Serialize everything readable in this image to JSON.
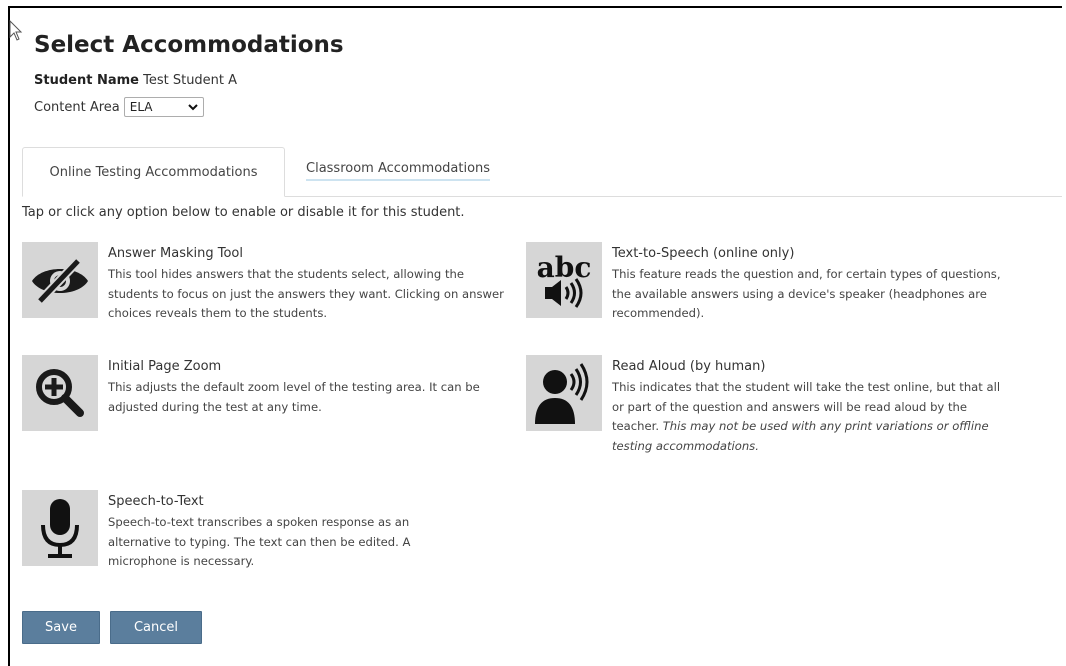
{
  "page": {
    "title": "Select Accommodations"
  },
  "student": {
    "label": "Student Name",
    "value": "Test Student A"
  },
  "content_area": {
    "label": "Content Area",
    "selected": "ELA"
  },
  "tabs": [
    {
      "label": "Online Testing Accommodations",
      "active": true
    },
    {
      "label": "Classroom Accommodations",
      "active": false
    }
  ],
  "hint": "Tap or click any option below to enable or disable it for this student.",
  "accommodations": {
    "answer_masking": {
      "icon": "eye-slash-icon",
      "title": "Answer Masking Tool",
      "desc": "This tool hides answers that the students select, allowing the students to focus on just the answers they want. Clicking on answer choices reveals them to the students."
    },
    "text_to_speech": {
      "icon": "abc-speaker-icon",
      "icon_text": "abc",
      "title": "Text-to-Speech (online only)",
      "desc": "This feature reads the question and, for certain types of questions, the available answers using a device's speaker (headphones are recommended)."
    },
    "page_zoom": {
      "icon": "zoom-in-icon",
      "title": "Initial Page Zoom",
      "desc": "This adjusts the default zoom level of the testing area. It can be adjusted during the test at any time."
    },
    "read_aloud": {
      "icon": "person-speaking-icon",
      "title": "Read Aloud (by human)",
      "desc": "This indicates that the student will take the test online, but that all or part of the question and answers will be read aloud by the teacher.",
      "desc_italic": "This may not be used with any print variations or offline testing accommodations."
    },
    "speech_to_text": {
      "icon": "microphone-icon",
      "title": "Speech-to-Text",
      "desc": "Speech-to-text transcribes a spoken response as an alternative to typing. The text can then be edited. A microphone is necessary."
    }
  },
  "buttons": {
    "save": "Save",
    "cancel": "Cancel"
  },
  "colors": {
    "button": "#5b7e9d",
    "icon_bg": "#d6d6d6",
    "tab_underline": "#cde3f0"
  }
}
